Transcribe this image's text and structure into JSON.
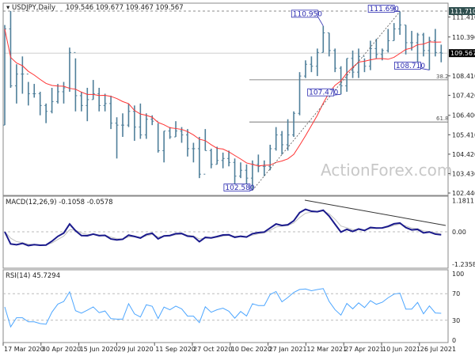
{
  "header": {
    "symbol": "USDJPY,Daily",
    "ohlc": "109.546 109.677 109.467 109.567"
  },
  "watermark": "ActionForex.com",
  "colors": {
    "bars": "#4f7f9a",
    "ma": "#ff3333",
    "macd": "#1a1a8c",
    "signal": "#c0c0c0",
    "rsi": "#4da6ff",
    "label": "#2b2bb0",
    "fib": "#666666"
  },
  "chart_data": [
    {
      "type": "ohlc",
      "title": "USDJPY,Daily",
      "ylim": [
        102.44,
        111.71
      ],
      "y_ticks": [
        "111.410",
        "110.390",
        "108.410",
        "107.420",
        "106.400",
        "105.410",
        "104.420",
        "103.430",
        "102.440"
      ],
      "current_price": "109.567",
      "high_line": "111.710",
      "x_ticks": [
        "17 Mar 2020",
        "30 Apr 2020",
        "15 Jun 2020",
        "29 Jul 2020",
        "11 Sep 2020",
        "27 Oct 2020",
        "10 Dec 2020",
        "27 Jan 2021",
        "12 Mar 2021",
        "27 Apr 2021",
        "10 Jun 2021",
        "26 Jul 2021"
      ],
      "moving_average": true,
      "high": [
        111.0,
        111.71,
        109.0,
        109.4,
        108.1,
        108.0,
        107.6,
        107.0,
        107.8,
        108.0,
        108.1,
        109.85,
        109.3,
        107.6,
        107.8,
        108.2,
        107.8,
        107.5,
        107.4,
        106.3,
        106.5,
        107.0,
        106.9,
        107.0,
        106.5,
        106.4,
        106.0,
        105.6,
        105.8,
        106.1,
        105.8,
        105.7,
        105.0,
        105.3,
        105.7,
        104.7,
        104.8,
        104.5,
        104.6,
        104.2,
        104.0,
        103.9,
        104.1,
        104.4,
        104.1,
        104.9,
        105.8,
        105.6,
        106.2,
        106.6,
        108.6,
        109.2,
        109.4,
        109.8,
        110.95,
        110.6,
        109.8,
        108.9,
        109.3,
        109.7,
        109.8,
        109.3,
        110.2,
        110.3,
        109.8,
        110.8,
        111.1,
        111.69,
        111.0,
        110.7,
        110.6,
        110.6,
        110.4,
        110.8,
        110.0
      ],
      "low": [
        105.9,
        107.8,
        107.0,
        107.5,
        106.9,
        107.3,
        106.4,
        106.0,
        106.5,
        107.0,
        107.0,
        107.6,
        106.6,
        106.6,
        106.1,
        107.2,
        106.6,
        106.6,
        105.7,
        104.2,
        105.3,
        105.8,
        105.1,
        105.2,
        105.2,
        105.9,
        104.5,
        104.0,
        105.2,
        105.3,
        105.0,
        104.3,
        104.0,
        103.2,
        104.6,
        103.7,
        103.9,
        103.7,
        103.8,
        102.9,
        103.2,
        102.9,
        102.58,
        103.5,
        103.3,
        103.6,
        104.6,
        104.4,
        104.6,
        105.3,
        106.4,
        108.3,
        108.6,
        108.4,
        109.6,
        109.4,
        108.6,
        107.47,
        107.6,
        108.3,
        108.3,
        108.6,
        108.7,
        109.3,
        109.2,
        109.6,
        110.2,
        110.5,
        109.5,
        109.7,
        109.1,
        109.4,
        108.71,
        109.4,
        109.1
      ],
      "close": [
        110.8,
        107.9,
        108.5,
        108.5,
        107.5,
        107.5,
        106.9,
        106.6,
        107.1,
        107.6,
        107.8,
        109.6,
        107.4,
        106.9,
        107.2,
        107.5,
        106.9,
        107.0,
        106.0,
        105.9,
        105.9,
        106.6,
        105.8,
        105.4,
        106.2,
        106.1,
        104.6,
        105.6,
        105.3,
        105.6,
        105.4,
        104.7,
        104.7,
        103.4,
        104.6,
        103.9,
        104.1,
        104.2,
        104.0,
        103.3,
        103.6,
        103.2,
        103.9,
        103.8,
        103.8,
        104.7,
        105.4,
        104.9,
        105.4,
        106.5,
        108.4,
        109.0,
        108.9,
        109.6,
        110.6,
        109.7,
        108.8,
        107.9,
        109.3,
        108.6,
        109.4,
        108.9,
        109.8,
        109.5,
        109.7,
        110.2,
        110.8,
        111.0,
        110.1,
        110.1,
        110.5,
        109.7,
        110.2,
        109.6,
        109.567
      ],
      "annotations": [
        {
          "text": "102.580",
          "price": 102.58
        },
        {
          "text": "110.950",
          "price": 110.95
        },
        {
          "text": "107.470",
          "price": 107.47
        },
        {
          "text": "111.690",
          "price": 111.69
        },
        {
          "text": "108.710",
          "price": 108.71
        }
      ],
      "fibonacci": [
        {
          "text": "38.2",
          "price": 108.21
        },
        {
          "text": "61.8",
          "price": 106.06
        }
      ],
      "trendline": {
        "from": 102.58,
        "to": 111.69
      }
    },
    {
      "type": "line",
      "title": "MACD(12,26,9) -0.1058 -0.0578",
      "params": [
        12,
        26,
        9
      ],
      "ylim": [
        -1.2358,
        1.1811
      ],
      "y_ticks": [
        "1.1811",
        "0.00",
        "-1.2358"
      ]
    },
    {
      "type": "line",
      "title": "RSI(14) 45.7294",
      "period": 14,
      "ylim": [
        0,
        100
      ],
      "y_ticks": [
        "100",
        "70",
        "30",
        "0"
      ],
      "levels": [
        70,
        30
      ]
    }
  ]
}
